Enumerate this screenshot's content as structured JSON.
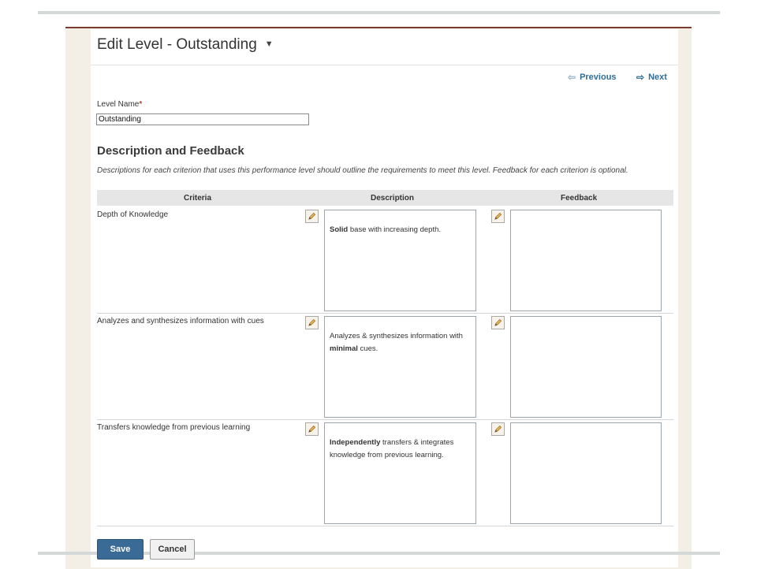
{
  "header": {
    "title": "Edit Level - Outstanding",
    "title_caret": "▼"
  },
  "nav": {
    "previous_label": "Previous",
    "next_label": "Next",
    "previous_icon": "arrow-left-icon",
    "next_icon": "arrow-right-icon"
  },
  "level_name": {
    "label": "Level Name",
    "required_marker": "*",
    "value": "Outstanding"
  },
  "description_feedback": {
    "title": "Description and Feedback",
    "help_text": "Descriptions for each criterion that uses this performance level should outline the requirements to meet this level. Feedback for each criterion is optional."
  },
  "table": {
    "headers": {
      "criteria": "Criteria",
      "description": "Description",
      "feedback": "Feedback"
    },
    "rows": [
      {
        "criterion": "Depth of Knowledge",
        "description": [
          {
            "text": "Solid",
            "bold": true
          },
          {
            "text": " base with increasing depth.",
            "bold": false
          }
        ],
        "feedback": ""
      },
      {
        "criterion": "Analyzes and synthesizes information with cues",
        "description": [
          {
            "text": "Analyzes & synthesizes information with ",
            "bold": false
          },
          {
            "text": "minimal",
            "bold": true
          },
          {
            "text": " cues.",
            "bold": false
          }
        ],
        "feedback": ""
      },
      {
        "criterion": "Transfers knowledge from previous learning",
        "description": [
          {
            "text": "Independently",
            "bold": true
          },
          {
            "text": " transfers & integrates knowledge from previous learning.",
            "bold": false
          }
        ],
        "feedback": ""
      }
    ],
    "edit_icon": "pencil-icon"
  },
  "actions": {
    "save_label": "Save",
    "cancel_label": "Cancel"
  },
  "colors": {
    "accent": "#3a6a96",
    "link": "#2d6d9a",
    "frame_border": "#7a3b2e",
    "required": "#b54a3a"
  }
}
